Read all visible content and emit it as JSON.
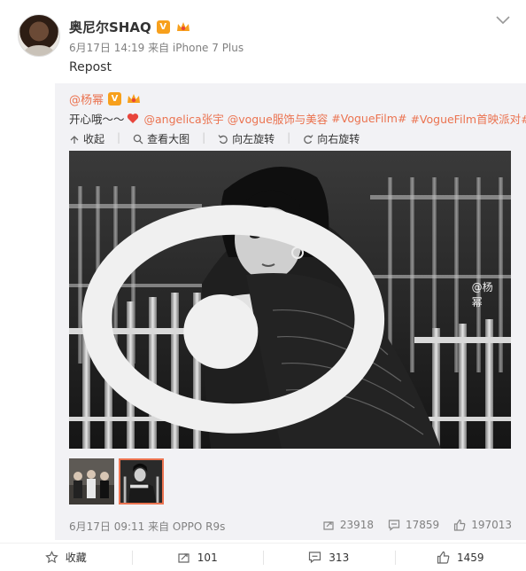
{
  "header": {
    "user_name": "奥尼尔SHAQ",
    "verified_badge": "V",
    "meta": "6月17日 14:19 来自 iPhone 7 Plus",
    "post_text": "Repost"
  },
  "repost": {
    "orig_user": "@杨幂",
    "verified_badge": "V",
    "text_prefix": "开心哦～～",
    "mentions": [
      "@angelica张宇",
      "@vogue服饰与美容",
      "#VogueFilm#",
      "#VogueFilm首映派对#"
    ],
    "actions": [
      "收起",
      "查看大图",
      "向左旋转",
      "向右旋转"
    ],
    "watermark": "@杨幂",
    "footer_meta": "6月17日 09:11 来自 OPPO R9s",
    "stats": {
      "forward": "23918",
      "comment": "17859",
      "like": "197013"
    }
  },
  "bottom_bar": {
    "favorite": "收藏",
    "forward": "101",
    "comment": "313",
    "like": "1459"
  },
  "colors": {
    "accent": "#eb7350",
    "badge": "#f7a01c",
    "repost_bg": "#f2f2f5"
  }
}
